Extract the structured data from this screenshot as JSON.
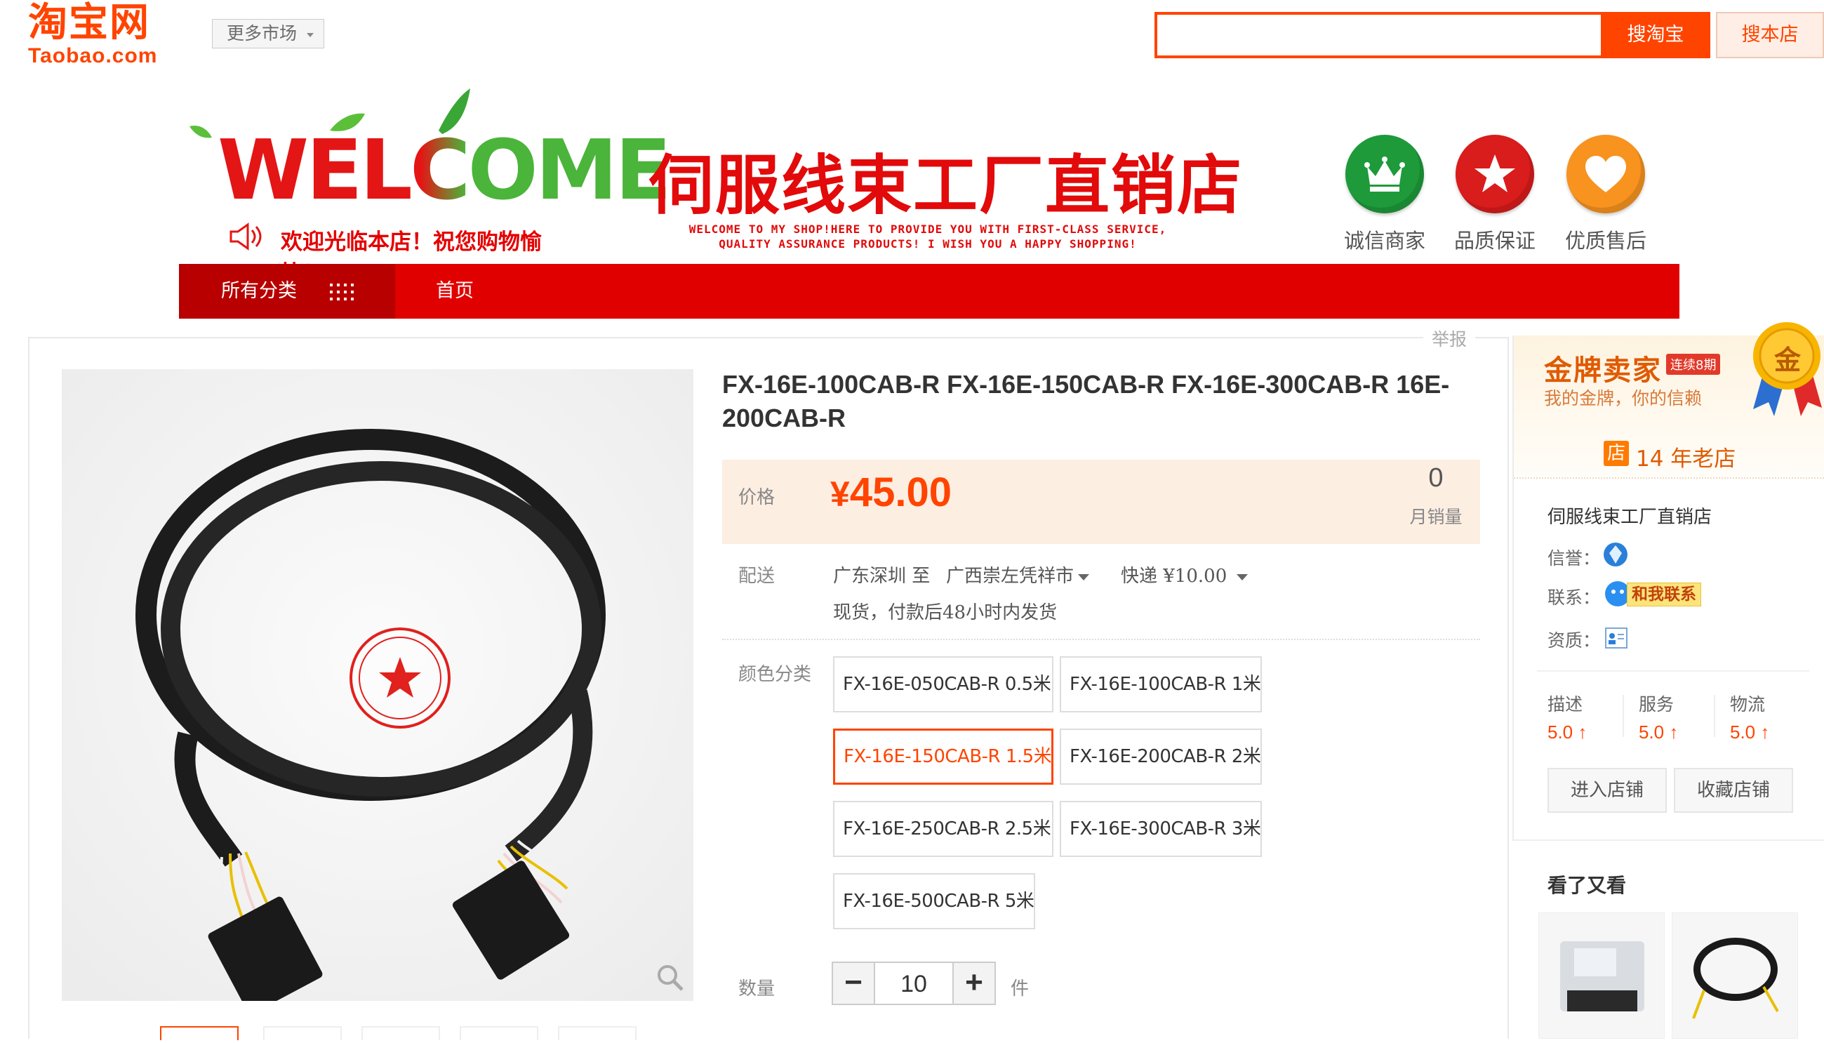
{
  "header": {
    "logo_cn": "淘宝网",
    "logo_en": "Taobao.com",
    "market_dropdown": "更多市场",
    "search_placeholder": "",
    "search_button": "搜淘宝",
    "shop_search_button": "搜本店"
  },
  "banner": {
    "welcome_word": "WELCOME",
    "welcome_sub": "欢迎光临本店！祝您购物愉快！",
    "shop_title": "伺服线束工厂直销店",
    "tagline_line1": "WELCOME TO MY SHOP!HERE TO PROVIDE YOU WITH FIRST-CLASS SERVICE,",
    "tagline_line2": "QUALITY ASSURANCE PRODUCTS! I WISH YOU A HAPPY SHOPPING!",
    "badges": [
      {
        "label": "诚信商家",
        "color": "#1e9a3a",
        "icon": "crown-icon"
      },
      {
        "label": "品质保证",
        "color": "#d91c1c",
        "icon": "star-icon"
      },
      {
        "label": "优质售后",
        "color": "#f7931e",
        "icon": "heart-icon"
      }
    ]
  },
  "nav": {
    "all_categories": "所有分类",
    "home": "首页"
  },
  "product": {
    "report": "举报",
    "title": "FX-16E-100CAB-R FX-16E-150CAB-R FX-16E-300CAB-R 16E-200CAB-R",
    "price_label": "价格",
    "price_currency": "¥",
    "price_value": "45.00",
    "monthly_sales_value": "0",
    "monthly_sales_label": "月销量",
    "delivery_label": "配送",
    "delivery_from": "广东深圳 至",
    "delivery_to": "广西崇左凭祥市",
    "delivery_method": "快递 ¥10.00",
    "delivery_note": "现货，付款后48小时内发货",
    "color_label": "颜色分类",
    "skus": [
      {
        "label": "FX-16E-050CAB-R 0.5米",
        "selected": false
      },
      {
        "label": "FX-16E-100CAB-R 1米",
        "selected": false
      },
      {
        "label": "FX-16E-150CAB-R 1.5米",
        "selected": true
      },
      {
        "label": "FX-16E-200CAB-R 2米",
        "selected": false
      },
      {
        "label": "FX-16E-250CAB-R 2.5米",
        "selected": false
      },
      {
        "label": "FX-16E-300CAB-R 3米",
        "selected": false
      },
      {
        "label": "FX-16E-500CAB-R 5米",
        "selected": false
      }
    ],
    "quantity_label": "数量",
    "quantity_value": "10",
    "quantity_unit": "件",
    "minus": "−",
    "plus": "+"
  },
  "seller": {
    "gold_title": "金牌卖家",
    "gold_streak": "连续8期",
    "gold_slogan": "我的金牌，你的信赖",
    "medal_char": "金",
    "years_icon": "店",
    "years_text": "14 年老店",
    "shop_name": "伺服线束工厂直销店",
    "credit_label": "信誉：",
    "contact_label": "联系：",
    "contact_button": "和我联系",
    "qualification_label": "资质：",
    "scores": [
      {
        "label": "描述",
        "value": "5.0 ↑"
      },
      {
        "label": "服务",
        "value": "5.0 ↑"
      },
      {
        "label": "物流",
        "value": "5.0 ↑"
      }
    ],
    "enter_shop": "进入店铺",
    "favorite_shop": "收藏店铺",
    "see_also": "看了又看"
  },
  "colors": {
    "accent": "#ff4400",
    "nav_red": "#e00000",
    "price_bg": "#fdeee2"
  }
}
